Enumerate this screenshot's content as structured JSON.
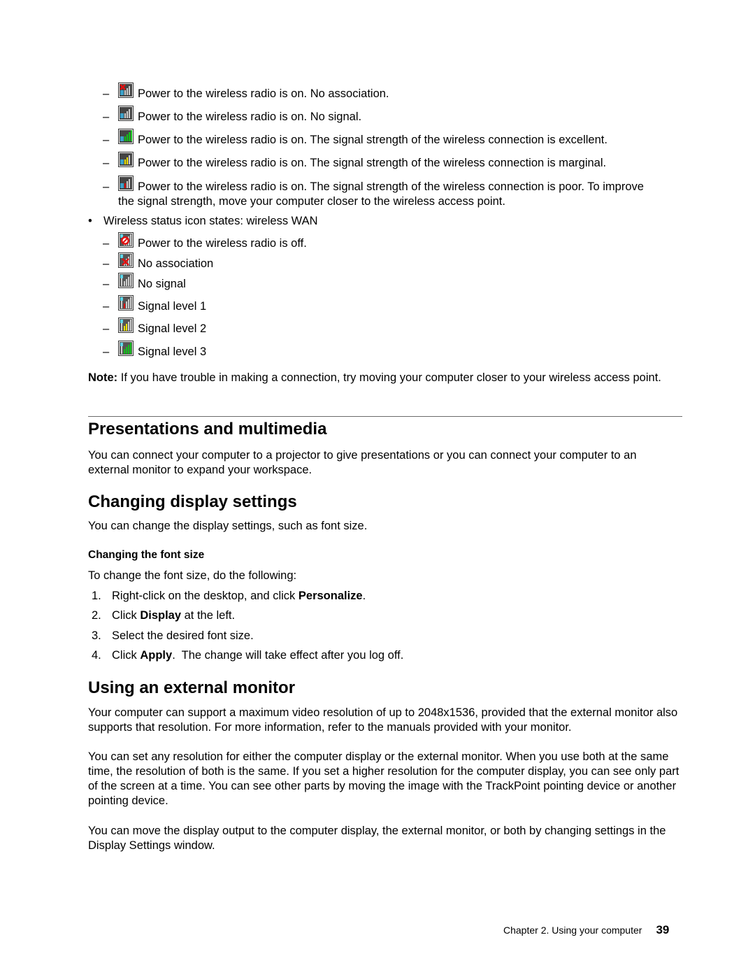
{
  "wifi_states": [
    {
      "icon": "wireless-lan-no-association-icon",
      "text": "Power to the wireless radio is on. No association."
    },
    {
      "icon": "wireless-lan-no-signal-icon",
      "text": "Power to the wireless radio is on. No signal."
    },
    {
      "icon": "wireless-lan-signal-excellent-icon",
      "text": "Power to the wireless radio is on. The signal strength of the wireless connection is excellent."
    },
    {
      "icon": "wireless-lan-signal-marginal-icon",
      "text": "Power to the wireless radio is on. The signal strength of the wireless connection is marginal."
    },
    {
      "icon": "wireless-lan-signal-poor-icon",
      "text": "Power to the wireless radio is on. The signal strength of the wireless connection is poor. To improve",
      "text2": "the signal strength, move your computer closer to the wireless access point."
    }
  ],
  "wan_bullet": "Wireless status icon states: wireless WAN",
  "wan_states": [
    {
      "icon": "wireless-wan-off-icon",
      "text": "Power to the wireless radio is off."
    },
    {
      "icon": "wireless-wan-no-association-icon",
      "text": "No association"
    },
    {
      "icon": "wireless-wan-no-signal-icon",
      "text": "No signal"
    },
    {
      "icon": "wireless-wan-signal-level-1-icon",
      "text": "Signal level 1"
    },
    {
      "icon": "wireless-wan-signal-level-2-icon",
      "text": "Signal level 2"
    },
    {
      "icon": "wireless-wan-signal-level-3-icon",
      "text": "Signal level 3"
    }
  ],
  "note": {
    "label": "Note:",
    "text": " If you have trouble in making a connection, try moving your computer closer to your wireless access point."
  },
  "sections": {
    "presentations": {
      "title": "Presentations and multimedia",
      "body": "You can connect your computer to a projector to give presentations or you can connect your computer to an external monitor to expand your workspace."
    },
    "display": {
      "title": "Changing display settings",
      "body": "You can change the display settings, such as font size.",
      "sub_title": "Changing the font size",
      "intro": "To change the font size, do the following:",
      "steps": [
        {
          "num": "1.",
          "pre": "Right-click on the desktop, and click ",
          "bold": "Personalize",
          "post": "."
        },
        {
          "num": "2.",
          "pre": "Click ",
          "bold": "Display",
          "post": " at the left."
        },
        {
          "num": "3.",
          "pre": "Select the desired font size.",
          "bold": "",
          "post": ""
        },
        {
          "num": "4.",
          "pre": "Click ",
          "bold": "Apply",
          "post": ".  The change will take effect after you log off."
        }
      ]
    },
    "monitor": {
      "title": "Using an external monitor",
      "p1": "Your computer can support a maximum video resolution of up to 2048x1536, provided that the external monitor also supports that resolution. For more information, refer to the manuals provided with your monitor.",
      "p2": "You can set any resolution for either the computer display or the external monitor. When you use both at the same time, the resolution of both is the same. If you set a higher resolution for the computer display, you can see only part of the screen at a time. You can see other parts by moving the image with the TrackPoint pointing device or another pointing device.",
      "p3": "You can move the display output to the computer display, the external monitor, or both by changing settings in the Display Settings window."
    }
  },
  "footer": {
    "chapter": "Chapter 2. Using your computer",
    "page": "39"
  },
  "colors": {
    "signal_green": "#12c21a",
    "signal_yellow": "#f2e600",
    "signal_red": "#e01010",
    "rule": "#6b6b6b"
  }
}
